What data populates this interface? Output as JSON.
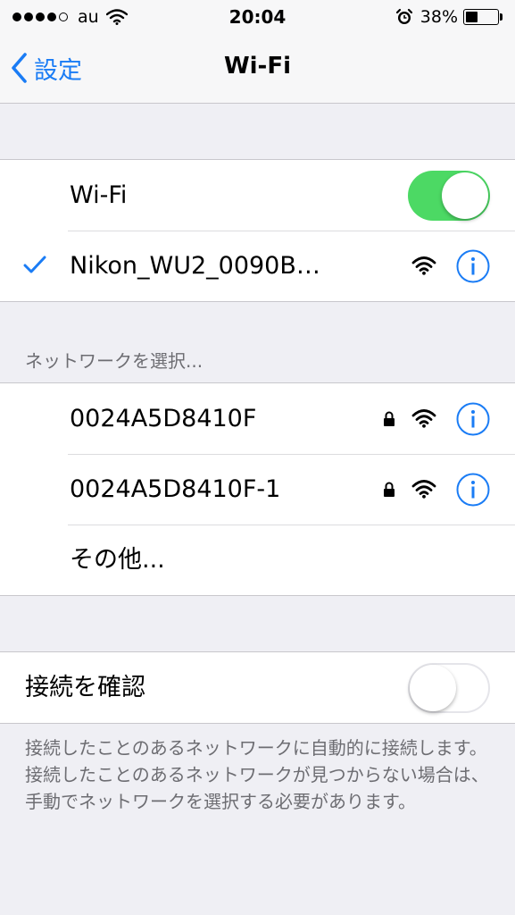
{
  "status_bar": {
    "carrier": "au",
    "time": "20:04",
    "battery_percent": "38%",
    "signal_dots_filled": 4,
    "signal_dots_total": 5,
    "battery_level": 0.38
  },
  "nav": {
    "back_label": "設定",
    "title": "Wi-Fi"
  },
  "wifi_toggle": {
    "label": "Wi-Fi",
    "state": "on"
  },
  "connected_network": {
    "name": "Nikon_WU2_0090B…",
    "icons": [
      "checkmark-icon",
      "wifi-signal-icon",
      "info-icon"
    ]
  },
  "choose_network_header": "ネットワークを選択...",
  "networks": [
    {
      "name": "0024A5D8410F",
      "locked": true
    },
    {
      "name": "0024A5D8410F-1",
      "locked": true
    },
    {
      "name": "その他..."
    }
  ],
  "ask_to_join": {
    "label": "接続を確認",
    "state": "off"
  },
  "footer": "接続したことのあるネットワークに自動的に接続します。接続したことのあるネットワークが見つからない場合は、手動でネットワークを選択する必要があります。",
  "colors": {
    "accent": "#1a7cf5",
    "toggle_on": "#4cd964",
    "background": "#efeff4"
  }
}
